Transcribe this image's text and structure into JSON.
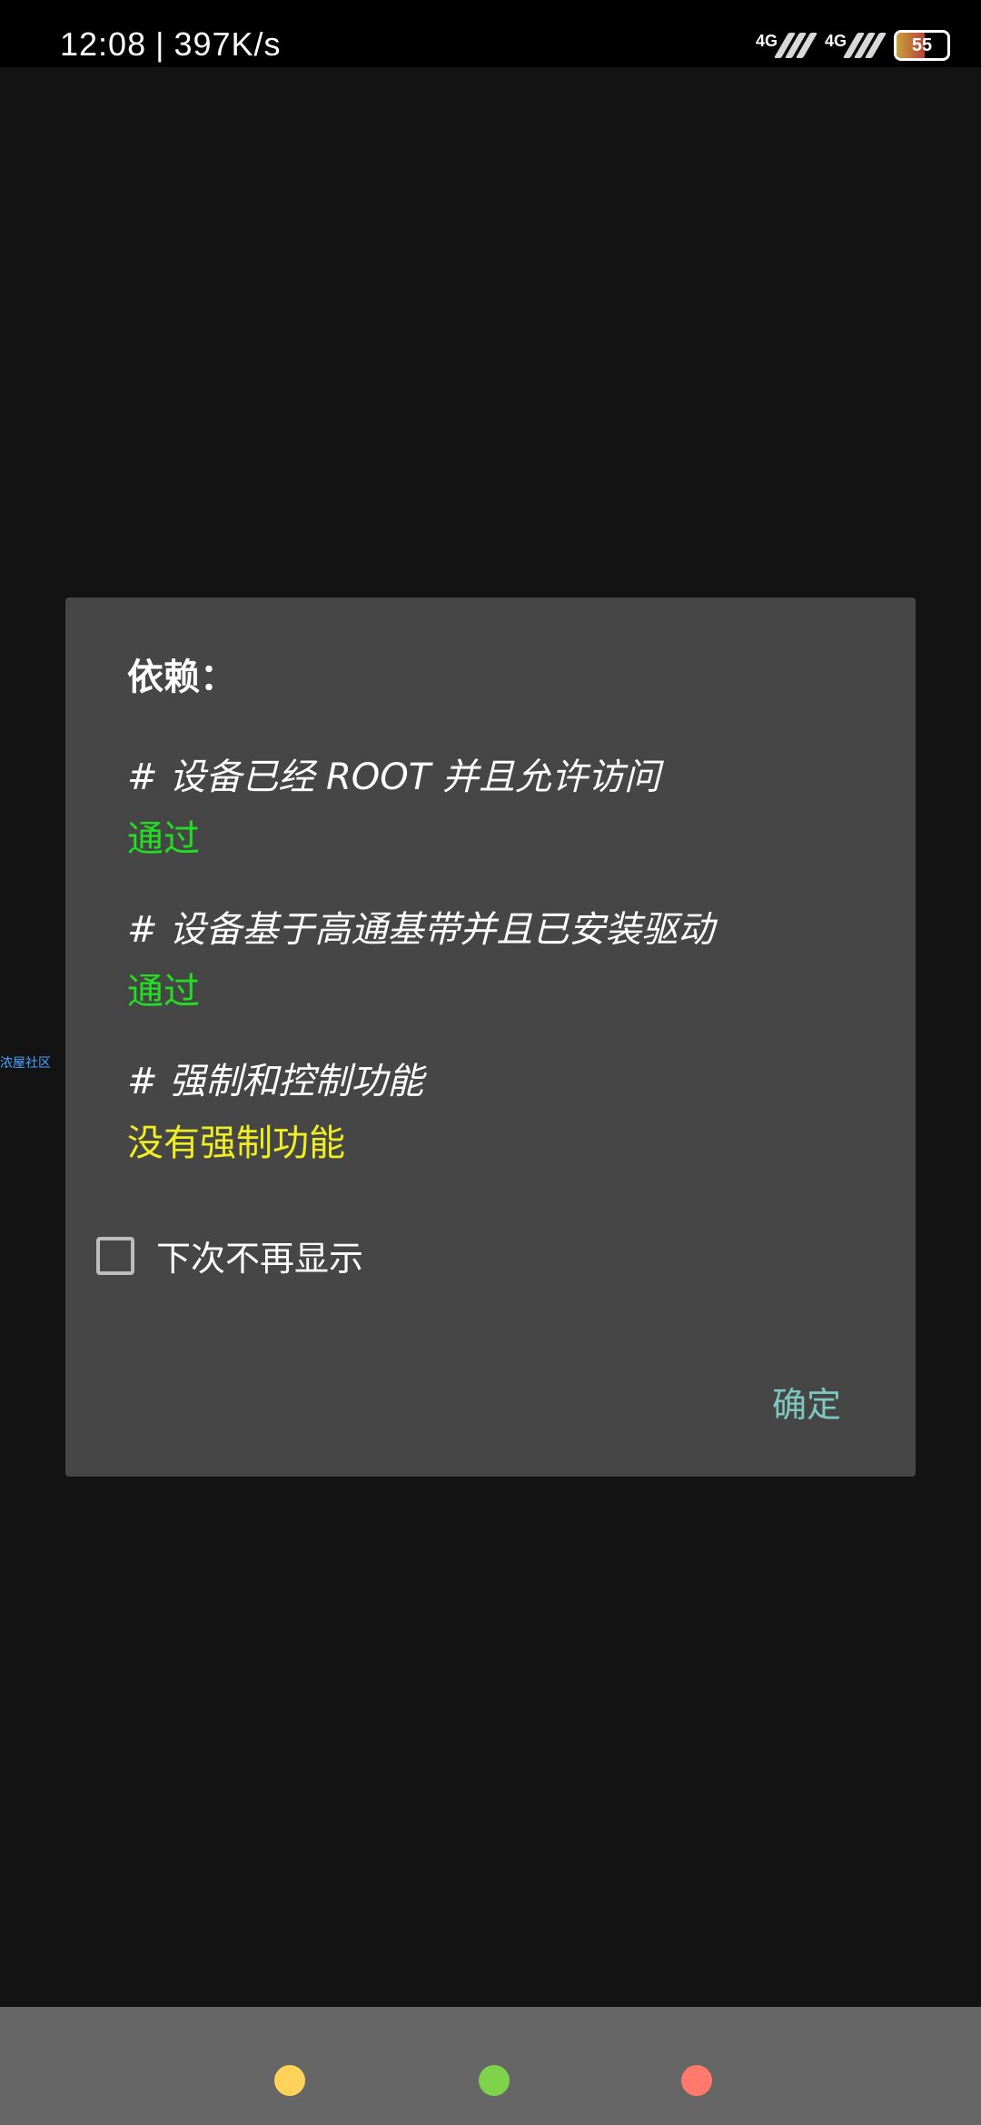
{
  "status_bar": {
    "time": "12:08",
    "separator": "|",
    "speed": "397K/s",
    "signal1_label": "4G",
    "signal2_label": "4G",
    "battery": "55",
    "battery_level_percent": 55
  },
  "dialog": {
    "title": "依赖：",
    "deps": [
      {
        "question": "# 设备已经 ROOT 并且允许访问",
        "result": "通过"
      },
      {
        "question": "# 设备基于高通基带并且已安装驱动",
        "result": "通过"
      },
      {
        "question": "# 强制和控制功能",
        "result": "没有强制功能"
      }
    ],
    "checkbox_label": "下次不再显示",
    "confirm_label": "确定"
  },
  "side_label": "浓屋社区",
  "colors": {
    "pass": "#22dd22",
    "warn": "#eeee22",
    "accent": "#7fc8c0",
    "dot_yellow": "#ffd25a",
    "dot_green": "#7fd34a",
    "dot_red": "#ff7a6a"
  }
}
